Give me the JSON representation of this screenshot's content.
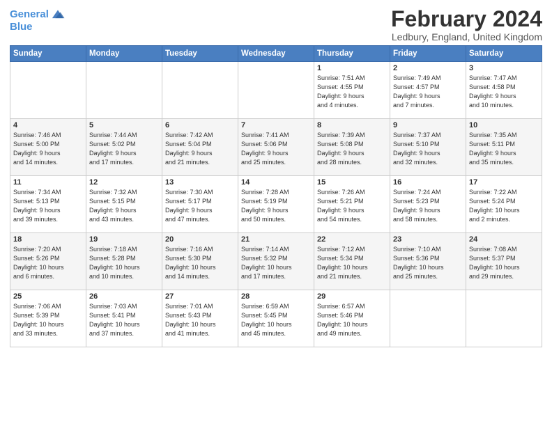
{
  "logo": {
    "line1": "General",
    "line2": "Blue"
  },
  "title": "February 2024",
  "location": "Ledbury, England, United Kingdom",
  "weekdays": [
    "Sunday",
    "Monday",
    "Tuesday",
    "Wednesday",
    "Thursday",
    "Friday",
    "Saturday"
  ],
  "weeks": [
    [
      {
        "day": "",
        "info": ""
      },
      {
        "day": "",
        "info": ""
      },
      {
        "day": "",
        "info": ""
      },
      {
        "day": "",
        "info": ""
      },
      {
        "day": "1",
        "info": "Sunrise: 7:51 AM\nSunset: 4:55 PM\nDaylight: 9 hours\nand 4 minutes."
      },
      {
        "day": "2",
        "info": "Sunrise: 7:49 AM\nSunset: 4:57 PM\nDaylight: 9 hours\nand 7 minutes."
      },
      {
        "day": "3",
        "info": "Sunrise: 7:47 AM\nSunset: 4:58 PM\nDaylight: 9 hours\nand 10 minutes."
      }
    ],
    [
      {
        "day": "4",
        "info": "Sunrise: 7:46 AM\nSunset: 5:00 PM\nDaylight: 9 hours\nand 14 minutes."
      },
      {
        "day": "5",
        "info": "Sunrise: 7:44 AM\nSunset: 5:02 PM\nDaylight: 9 hours\nand 17 minutes."
      },
      {
        "day": "6",
        "info": "Sunrise: 7:42 AM\nSunset: 5:04 PM\nDaylight: 9 hours\nand 21 minutes."
      },
      {
        "day": "7",
        "info": "Sunrise: 7:41 AM\nSunset: 5:06 PM\nDaylight: 9 hours\nand 25 minutes."
      },
      {
        "day": "8",
        "info": "Sunrise: 7:39 AM\nSunset: 5:08 PM\nDaylight: 9 hours\nand 28 minutes."
      },
      {
        "day": "9",
        "info": "Sunrise: 7:37 AM\nSunset: 5:10 PM\nDaylight: 9 hours\nand 32 minutes."
      },
      {
        "day": "10",
        "info": "Sunrise: 7:35 AM\nSunset: 5:11 PM\nDaylight: 9 hours\nand 35 minutes."
      }
    ],
    [
      {
        "day": "11",
        "info": "Sunrise: 7:34 AM\nSunset: 5:13 PM\nDaylight: 9 hours\nand 39 minutes."
      },
      {
        "day": "12",
        "info": "Sunrise: 7:32 AM\nSunset: 5:15 PM\nDaylight: 9 hours\nand 43 minutes."
      },
      {
        "day": "13",
        "info": "Sunrise: 7:30 AM\nSunset: 5:17 PM\nDaylight: 9 hours\nand 47 minutes."
      },
      {
        "day": "14",
        "info": "Sunrise: 7:28 AM\nSunset: 5:19 PM\nDaylight: 9 hours\nand 50 minutes."
      },
      {
        "day": "15",
        "info": "Sunrise: 7:26 AM\nSunset: 5:21 PM\nDaylight: 9 hours\nand 54 minutes."
      },
      {
        "day": "16",
        "info": "Sunrise: 7:24 AM\nSunset: 5:23 PM\nDaylight: 9 hours\nand 58 minutes."
      },
      {
        "day": "17",
        "info": "Sunrise: 7:22 AM\nSunset: 5:24 PM\nDaylight: 10 hours\nand 2 minutes."
      }
    ],
    [
      {
        "day": "18",
        "info": "Sunrise: 7:20 AM\nSunset: 5:26 PM\nDaylight: 10 hours\nand 6 minutes."
      },
      {
        "day": "19",
        "info": "Sunrise: 7:18 AM\nSunset: 5:28 PM\nDaylight: 10 hours\nand 10 minutes."
      },
      {
        "day": "20",
        "info": "Sunrise: 7:16 AM\nSunset: 5:30 PM\nDaylight: 10 hours\nand 14 minutes."
      },
      {
        "day": "21",
        "info": "Sunrise: 7:14 AM\nSunset: 5:32 PM\nDaylight: 10 hours\nand 17 minutes."
      },
      {
        "day": "22",
        "info": "Sunrise: 7:12 AM\nSunset: 5:34 PM\nDaylight: 10 hours\nand 21 minutes."
      },
      {
        "day": "23",
        "info": "Sunrise: 7:10 AM\nSunset: 5:36 PM\nDaylight: 10 hours\nand 25 minutes."
      },
      {
        "day": "24",
        "info": "Sunrise: 7:08 AM\nSunset: 5:37 PM\nDaylight: 10 hours\nand 29 minutes."
      }
    ],
    [
      {
        "day": "25",
        "info": "Sunrise: 7:06 AM\nSunset: 5:39 PM\nDaylight: 10 hours\nand 33 minutes."
      },
      {
        "day": "26",
        "info": "Sunrise: 7:03 AM\nSunset: 5:41 PM\nDaylight: 10 hours\nand 37 minutes."
      },
      {
        "day": "27",
        "info": "Sunrise: 7:01 AM\nSunset: 5:43 PM\nDaylight: 10 hours\nand 41 minutes."
      },
      {
        "day": "28",
        "info": "Sunrise: 6:59 AM\nSunset: 5:45 PM\nDaylight: 10 hours\nand 45 minutes."
      },
      {
        "day": "29",
        "info": "Sunrise: 6:57 AM\nSunset: 5:46 PM\nDaylight: 10 hours\nand 49 minutes."
      },
      {
        "day": "",
        "info": ""
      },
      {
        "day": "",
        "info": ""
      }
    ]
  ]
}
